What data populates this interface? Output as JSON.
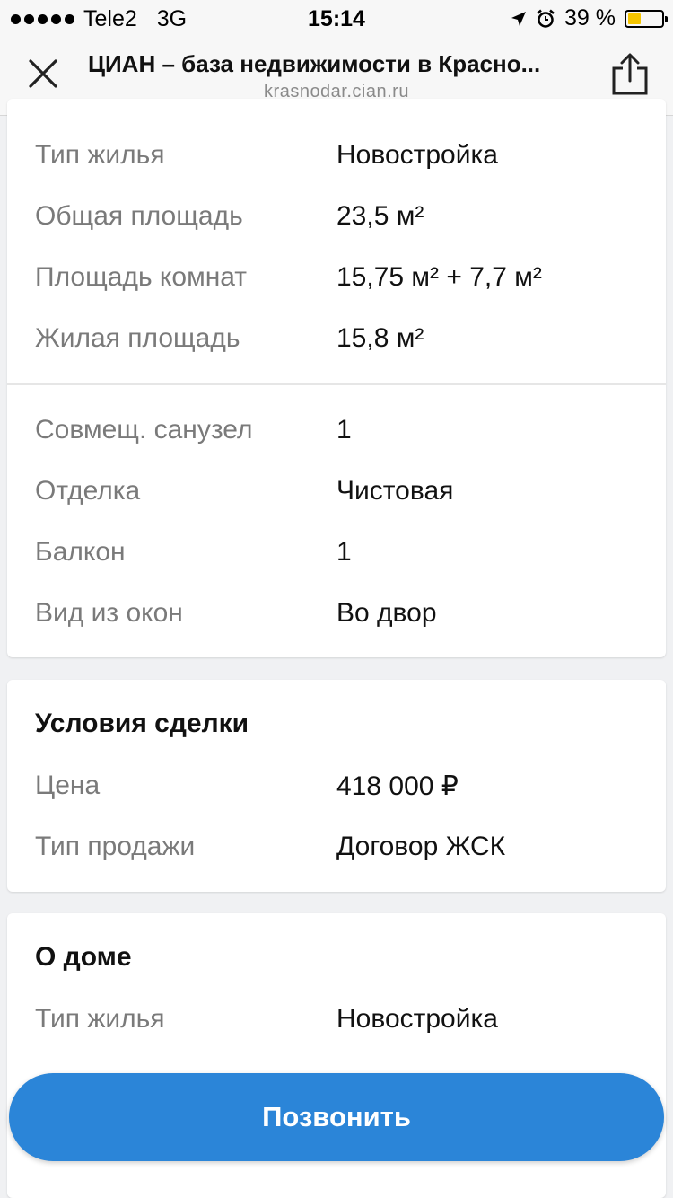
{
  "status_bar": {
    "carrier": "Tele2",
    "network": "3G",
    "time": "15:14",
    "battery": "39 %",
    "battery_level": 0.39,
    "icons": [
      "signal-dots-icon",
      "location-arrow-icon",
      "alarm-icon",
      "battery-icon"
    ]
  },
  "browser": {
    "title": "ЦИАН – база недвижимости в Красно...",
    "url": "krasnodar.cian.ru",
    "icons": [
      "close-icon",
      "share-icon"
    ]
  },
  "card1": {
    "rows_a": [
      {
        "label": "Тип жилья",
        "value": "Новостройка"
      },
      {
        "label": "Общая площадь",
        "value": "23,5 м²"
      },
      {
        "label": "Площадь комнат",
        "value": "15,75 м² + 7,7 м²"
      },
      {
        "label": "Жилая площадь",
        "value": "15,8 м²"
      }
    ],
    "rows_b": [
      {
        "label": "Совмещ. санузел",
        "value": "1"
      },
      {
        "label": "Отделка",
        "value": "Чистовая"
      },
      {
        "label": "Балкон",
        "value": "1"
      },
      {
        "label": "Вид из окон",
        "value": "Во двор"
      }
    ]
  },
  "deal": {
    "title": "Условия сделки",
    "rows": [
      {
        "label": "Цена",
        "value": "418 000 ₽"
      },
      {
        "label": "Тип продажи",
        "value": "Договор ЖСК"
      }
    ]
  },
  "house": {
    "title": "О доме",
    "rows": [
      {
        "label": "Тип жилья",
        "value": "Новостройка"
      }
    ]
  },
  "call_button": {
    "label": "Позвонить",
    "color": "#2b85d8"
  }
}
